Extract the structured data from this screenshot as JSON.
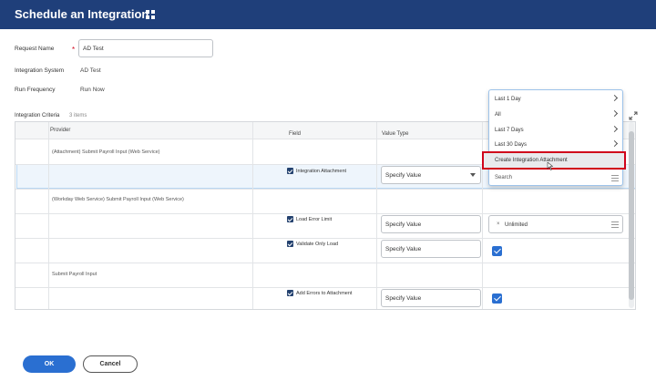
{
  "header": {
    "title": "Schedule an Integration",
    "related_icon": "related-actions-icon"
  },
  "form": {
    "request_name_label": "Request Name",
    "request_name_value": "AD Test",
    "integration_system_label": "Integration System",
    "integration_system_value": "AD Test",
    "run_frequency_label": "Run Frequency",
    "run_frequency_value": "Run Now"
  },
  "criteria": {
    "label": "Integration Criteria",
    "count": "3 items",
    "columns": [
      "Provider",
      "Field",
      "Value Type"
    ],
    "rows": [
      {
        "provider": "(Attachment) Submit Payroll Input (Web Service)"
      },
      {
        "field": "Integration Attachment",
        "value_type": "Specify Value"
      },
      {
        "provider": "(Workday Web Service) Submit Payroll Input (Web Service)"
      },
      {
        "field": "Load Error Limit",
        "value_type": "Specify Value",
        "value": "Unlimited"
      },
      {
        "field": "Validate Only Load",
        "value_type": "Specify Value"
      },
      {
        "provider": "Submit Payroll Input"
      },
      {
        "field": "Add Errors to Attachment",
        "value_type": "Specify Value"
      }
    ]
  },
  "dropdown": {
    "items": [
      "Last 1 Day",
      "All",
      "Last 7 Days",
      "Last 30 Days"
    ],
    "highlighted": "Create Integration Attachment",
    "search_placeholder": "Search"
  },
  "footer": {
    "ok_label": "OK",
    "cancel_label": "Cancel"
  },
  "colors": {
    "header_bg": "#1f3f7a",
    "primary": "#2a6fd1",
    "highlight_border": "#d0021b"
  }
}
